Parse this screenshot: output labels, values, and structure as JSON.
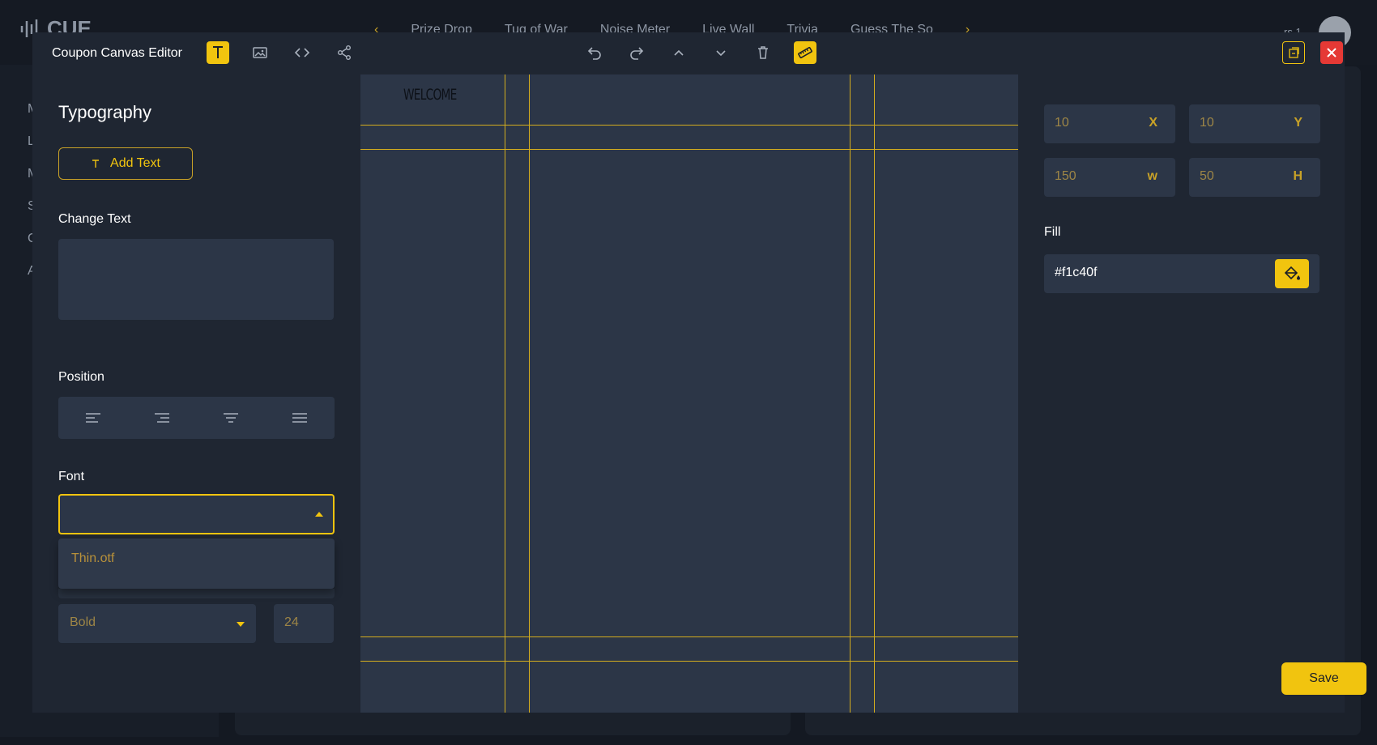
{
  "background": {
    "logo": "CUE",
    "tabs": [
      "Prize Drop",
      "Tug of War",
      "Noise Meter",
      "Live Wall",
      "Trivia",
      "Guess The So"
    ],
    "sidebar_letters": [
      "M",
      "L",
      "M",
      "S",
      "C",
      "A"
    ],
    "user_label": "rs 1"
  },
  "editor": {
    "title": "Coupon Canvas Editor",
    "toolbar_icons": [
      "text-icon",
      "image-icon",
      "code-icon",
      "share-icon",
      "undo-icon",
      "redo-icon",
      "chevron-up-icon",
      "chevron-down-icon",
      "trash-icon",
      "ruler-icon",
      "layers-icon",
      "close-icon"
    ],
    "accent_color": "#f1c40f",
    "close_color": "#e53935"
  },
  "left_panel": {
    "heading": "Typography",
    "add_text_label": "Add Text",
    "change_text_label": "Change Text",
    "change_text_value": "",
    "position_label": "Position",
    "alignments": [
      "align-left-icon",
      "align-right-icon",
      "align-center-icon",
      "align-justify-icon"
    ],
    "font_label": "Font",
    "font_selected": "",
    "font_options": [
      "Thin.otf"
    ],
    "weight_value": "Bold",
    "size_value": "24"
  },
  "canvas": {
    "element_text": "WELCOME"
  },
  "right_panel": {
    "x_value": "10",
    "x_unit": "X",
    "y_value": "10",
    "y_unit": "Y",
    "w_value": "150",
    "w_unit": "w",
    "h_value": "50",
    "h_unit": "H",
    "fill_label": "Fill",
    "fill_value": "#f1c40f"
  },
  "save_label": "Save"
}
